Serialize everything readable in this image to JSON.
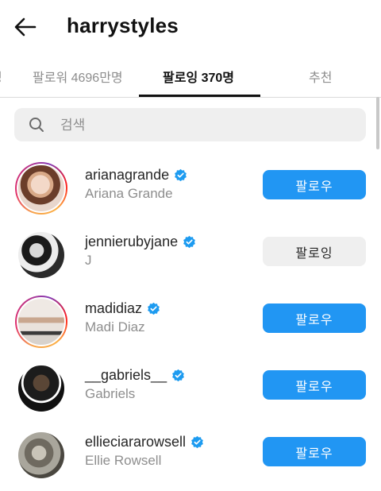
{
  "header": {
    "title": "harrystyles",
    "back_icon": "arrow-left-icon"
  },
  "tabs": [
    {
      "label": "명"
    },
    {
      "label": "팔로워 4696만명"
    },
    {
      "label": "팔로잉 370명",
      "active": true
    },
    {
      "label": "추천"
    }
  ],
  "search": {
    "placeholder": "검색",
    "value": ""
  },
  "accounts": [
    {
      "username": "arianagrande",
      "name": "Ariana Grande",
      "verified": true,
      "button": "팔로우",
      "following": false,
      "story_ring": true
    },
    {
      "username": "jennierubyjane",
      "name": "J",
      "verified": true,
      "button": "팔로잉",
      "following": true,
      "story_ring": false
    },
    {
      "username": "madidiaz",
      "name": "Madi Diaz",
      "verified": true,
      "button": "팔로우",
      "following": false,
      "story_ring": true
    },
    {
      "username": "__gabriels__",
      "name": "Gabriels",
      "verified": true,
      "button": "팔로우",
      "following": false,
      "story_ring": false
    },
    {
      "username": "ellieciararowsell",
      "name": "Ellie Rowsell",
      "verified": true,
      "button": "팔로우",
      "following": false,
      "story_ring": false
    }
  ],
  "colors": {
    "follow_button": "#2196f3",
    "verified": "#1d9bf0",
    "following_button": "#efefef"
  }
}
